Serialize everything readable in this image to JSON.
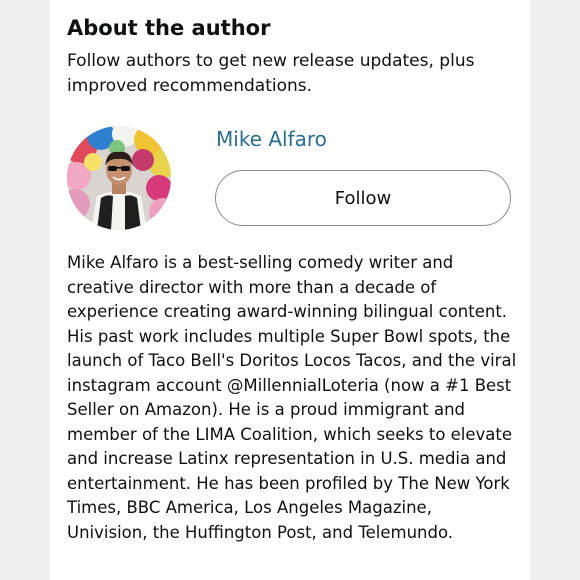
{
  "section": {
    "title": "About the author",
    "subtitle": "Follow authors to get new release updates, plus improved recommendations."
  },
  "author": {
    "name": "Mike Alfaro",
    "follow_label": "Follow",
    "bio": "Mike Alfaro is a best-selling comedy writer and creative director with more than a decade of experience creating award-winning bilingual content. His past work includes multiple Super Bowl spots, the launch of Taco Bell's Doritos Locos Tacos, and the viral instagram account @MillennialLoteria (now a #1 Best Seller on Amazon). He is a proud immigrant and member of the LIMA Coalition, which seeks to elevate and increase Latinx representation in U.S. media and entertainment. He has been profiled by The New York Times, BBC America, Los Angeles Magazine, Univision, the Huffington Post, and Telemundo."
  },
  "colors": {
    "link": "#2a6e91",
    "background": "#efefef",
    "card": "#ffffff",
    "text": "#0f1111"
  }
}
